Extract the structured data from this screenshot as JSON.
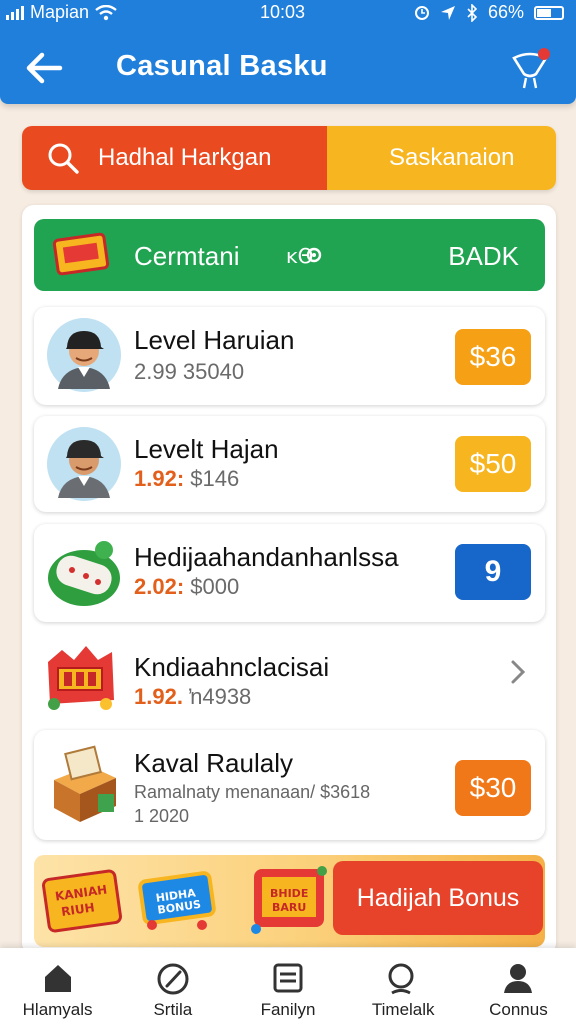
{
  "status": {
    "carrier": "Mapian",
    "time": "10:03",
    "battery": "66%"
  },
  "header": {
    "title": "Casunal Basku"
  },
  "search": {
    "label": "Hadhal Harkgan",
    "right_label": "Saskanaion"
  },
  "banner": {
    "title": "Cermtani",
    "gear_text": "ĸΘ",
    "action": "BADK"
  },
  "items": [
    {
      "name": "Level Haruian",
      "sub_hl": "",
      "sub": "2.99 35040",
      "badge": "$36"
    },
    {
      "name": "Levelt Hajan",
      "sub_hl": "1.92:",
      "sub": "$146",
      "badge": "$50"
    },
    {
      "name": "Hedijaahandanhanlssa",
      "sub_hl": "2.02:",
      "sub": "$000",
      "badge": "9"
    },
    {
      "name": "Kndiaahnclacisai",
      "sub_hl": "1.92.",
      "sub": "ŉ4938"
    },
    {
      "name": "Kaval Raulaly",
      "sub": "Ramalnaty menanaan/ $3618",
      "sub2": "1 2020",
      "badge": "$30"
    }
  ],
  "bonus": {
    "tile1": "KANIAH\nRIUH",
    "tile2": "HIDHA\nBONUS",
    "tile3": "BHIDE\nBARU",
    "button": "Hadijah Bonus"
  },
  "nav": [
    {
      "label": "Hlamyals",
      "icon": "home-icon"
    },
    {
      "label": "Srtila",
      "icon": "gauge-icon"
    },
    {
      "label": "Fanilyn",
      "icon": "list-icon"
    },
    {
      "label": "Timelalk",
      "icon": "search-icon"
    },
    {
      "label": "Connus",
      "icon": "profile-icon"
    }
  ],
  "colors": {
    "primary": "#1f7fdb",
    "search_red": "#ea4a1f",
    "search_yellow": "#f7b51f",
    "green": "#21a452",
    "badge_blue": "#1766c9",
    "bonus_red": "#e7432a"
  }
}
